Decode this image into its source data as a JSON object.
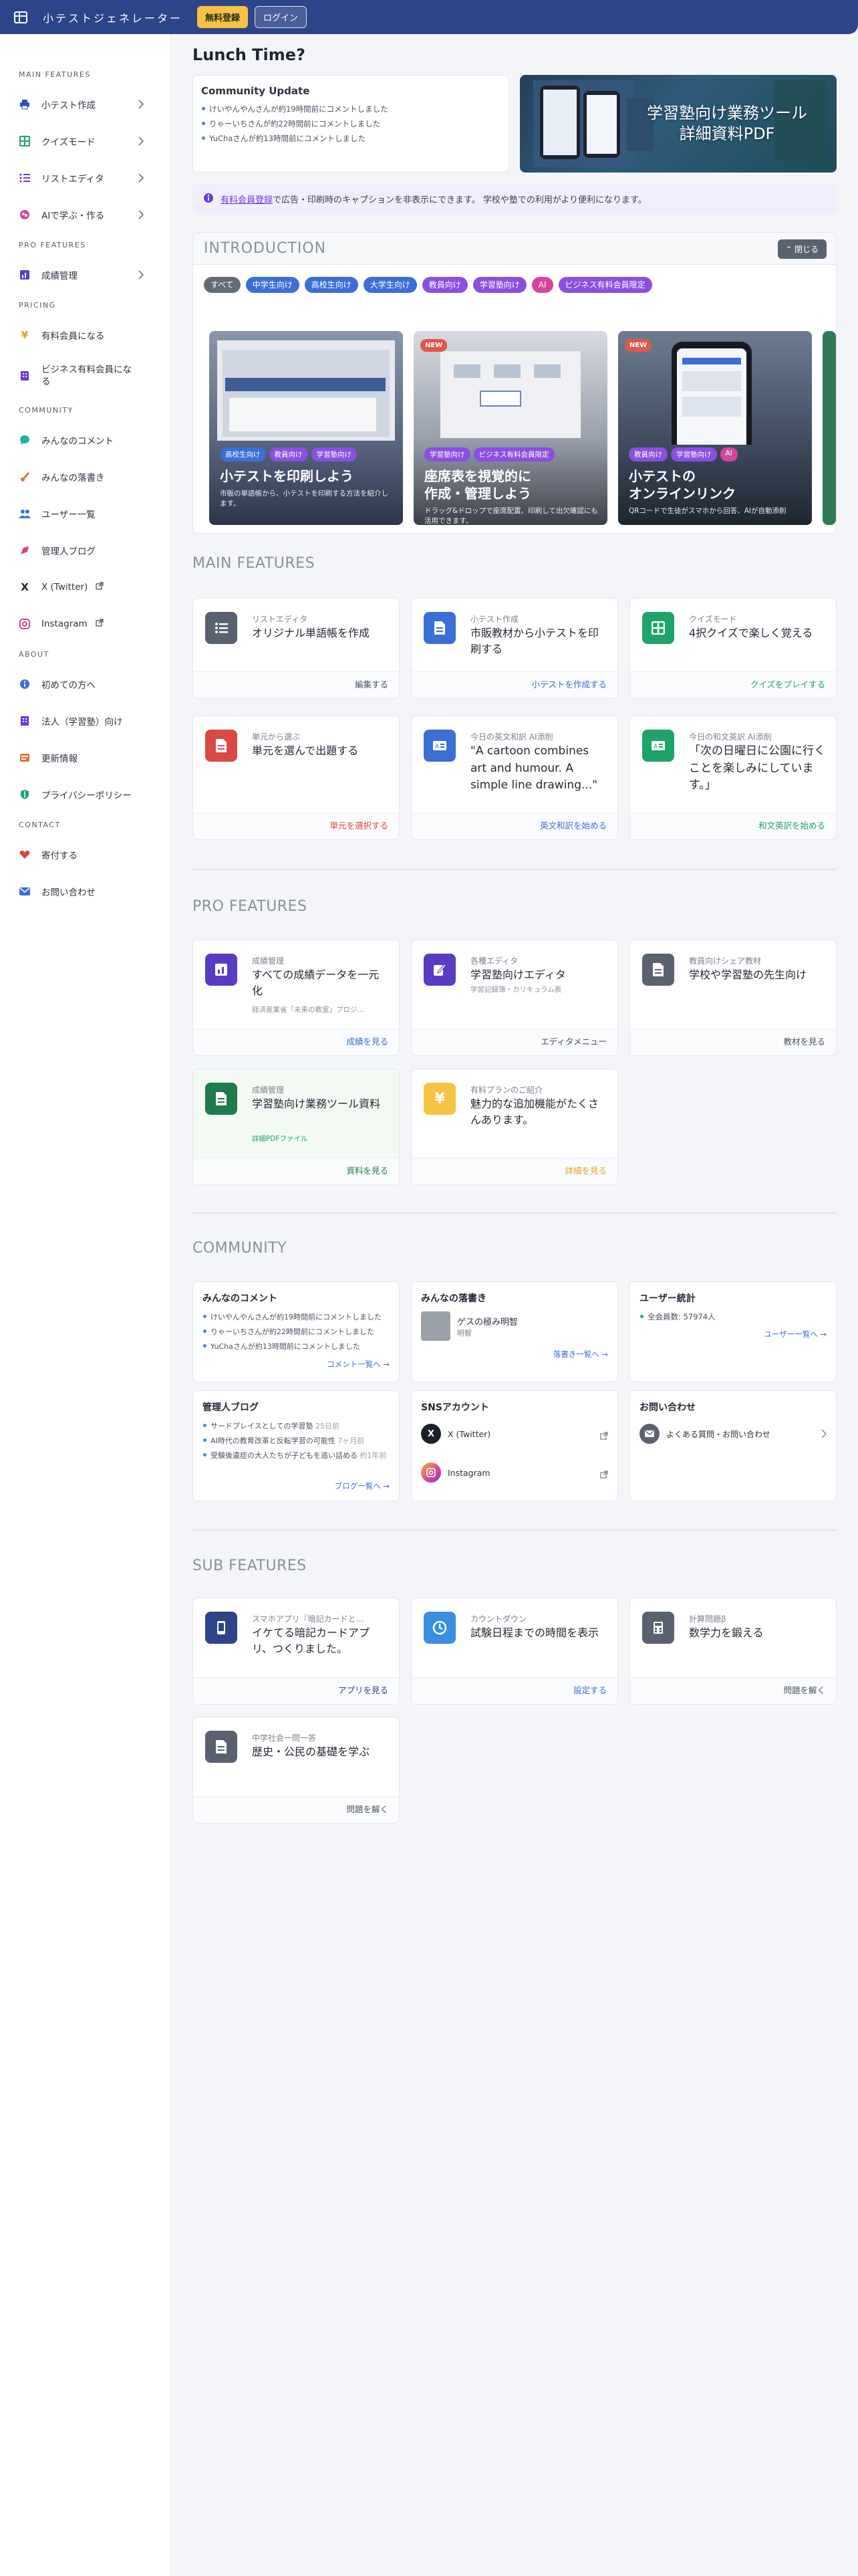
{
  "header": {
    "title": "小テストジェネレーター",
    "register_label": "無料登録",
    "login_label": "ログイン"
  },
  "sidebar": {
    "main_head": "MAIN FEATURES",
    "pro_head": "PRO FEATURES",
    "pricing_head": "PRICING",
    "community_head": "COMMUNITY",
    "about_head": "ABOUT",
    "contact_head": "CONTACT",
    "main": [
      "小テスト作成",
      "クイズモード",
      "リストエディタ",
      "AIで学ぶ・作る"
    ],
    "pro": [
      "成績管理"
    ],
    "pricing": [
      "有料会員になる",
      "ビジネス有料会員になる"
    ],
    "community": [
      "みんなのコメント",
      "みんなの落書き",
      "ユーザー一覧",
      "管理人ブログ",
      "X (Twitter)",
      "Instagram"
    ],
    "about": [
      "初めての方へ",
      "法人（学習塾）向け",
      "更新情報",
      "プライバシーポリシー"
    ],
    "contact": [
      "寄付する",
      "お問い合わせ"
    ]
  },
  "lunch_title": "Lunch Time?",
  "community_update": {
    "title": "Community Update",
    "items": [
      "けいやんやんさんが約19時間前にコメントしました",
      "りゃーいちさんが約22時間前にコメントしました",
      "YuChaさんが約13時間前にコメントしました"
    ]
  },
  "banner": {
    "line1": "学習塾向け業務ツール",
    "line2": "詳細資料PDF"
  },
  "notice": {
    "link": "有料会員登録",
    "text": "で広告・印刷時のキャプションを非表示にできます。 学校や塾での利用がより便利になります。"
  },
  "intro": {
    "title": "INTRODUCTION",
    "close_label": "閉じる",
    "chips": [
      "すべて",
      "中学生向け",
      "高校生向け",
      "大学生向け",
      "教員向け",
      "学習塾向け",
      "AI",
      "ビジネス有料会員限定"
    ],
    "slides": [
      {
        "tags": [
          "高校生向け",
          "教員向け",
          "学習塾向け"
        ],
        "title": "小テストを印刷しよう",
        "desc": "市販の単語帳から、小テストを印刷する方法を紹介します。",
        "new": ""
      },
      {
        "tags": [
          "学習塾向け",
          "ビジネス有料会員限定"
        ],
        "title1": "座席表を視覚的に",
        "title2": "作成・管理しよう",
        "desc": "ドラッグ&ドロップで座席配置。印刷して出欠確認にも活用できます。",
        "new": "NEW"
      },
      {
        "tags": [
          "教員向け",
          "学習塾向け",
          "AI"
        ],
        "title1": "小テストの",
        "title2": "オンラインリンク",
        "desc": "QRコードで生徒がスマホから回答、AIが自動添削",
        "new": "NEW"
      }
    ]
  },
  "main_features": {
    "title": "MAIN FEATURES",
    "cards": [
      {
        "cat": "リストエディタ",
        "title": "オリジナル単語帳を作成",
        "foot": "編集する"
      },
      {
        "cat": "小テスト作成",
        "title": "市販教材から小テストを印刷する",
        "foot": "小テストを作成する"
      },
      {
        "cat": "クイズモード",
        "title": "4択クイズで楽しく覚える",
        "foot": "クイズをプレイする"
      },
      {
        "cat": "単元から選ぶ",
        "title": "単元を選んで出題する",
        "foot": "単元を選択する"
      },
      {
        "cat": "今日の英文和訳 AI添削",
        "title": "\"A cartoon combines art and humour. A simple line drawing...\"",
        "foot": "英文和訳を始める"
      },
      {
        "cat": "今日の和文英訳 AI添削",
        "title": "「次の日曜日に公園に行くことを楽しみにしています。」",
        "foot": "和文英訳を始める"
      }
    ]
  },
  "pro_features": {
    "title": "PRO FEATURES",
    "cards": [
      {
        "cat": "成績管理",
        "title": "すべての成績データを一元化",
        "sub": "経済産業省「未来の教室」プロジ…",
        "foot": "成績を見る"
      },
      {
        "cat": "各種エディタ",
        "title": "学習塾向けエディタ",
        "sub": "学習記録簿・カリキュラム表",
        "foot": "エディタメニュー"
      },
      {
        "cat": "教員向けシェア教材",
        "title": "学校や学習塾の先生向け",
        "sub": "",
        "foot": "教材を見る"
      },
      {
        "cat": "成績管理",
        "title": "学習塾向け業務ツール資料",
        "sub": "詳細PDFファイル",
        "foot": "資料を見る"
      },
      {
        "cat": "有料プランのご紹介",
        "title": "魅力的な追加機能がたくさんあります。",
        "sub": "",
        "foot": "詳細を見る"
      }
    ]
  },
  "community": {
    "title": "COMMUNITY",
    "comments": {
      "title": "みんなのコメント",
      "items": [
        "けいやんやんさんが約19時間前にコメントしました",
        "りゃーいちさんが約22時間前にコメントしました",
        "YuChaさんが約13時間前にコメントしました"
      ],
      "more": "コメント一覧へ →"
    },
    "graffiti": {
      "title": "みんなの落書き",
      "name": "ゲスの極み明智",
      "user": "明智",
      "more": "落書き一覧へ →"
    },
    "users": {
      "title": "ユーザー統計",
      "total": "全会員数: 57974人",
      "more": "ユーザー一覧へ →"
    },
    "blog": {
      "title": "管理人ブログ",
      "items": [
        {
          "t": "サードプレイスとしての学習塾",
          "d": "25日前"
        },
        {
          "t": "AI時代の教育改革と反転学習の可能性",
          "d": "7ヶ月前"
        },
        {
          "t": "受験後遺症の大人たちが子どもを追い詰める",
          "d": "約1年前"
        }
      ],
      "more": "ブログ一覧へ →"
    },
    "sns": {
      "title": "SNSアカウント",
      "x": "X (Twitter)",
      "ig": "Instagram"
    },
    "contact": {
      "title": "お問い合わせ",
      "item": "よくある質問・お問い合わせ"
    }
  },
  "sub_features": {
    "title": "SUB FEATURES",
    "cards": [
      {
        "cat": "スマホアプリ『暗記カードと…",
        "title": "イケてる暗記カードアプリ、つくりました。",
        "foot": "アプリを見る"
      },
      {
        "cat": "カウントダウン",
        "title": "試験日程までの時間を表示",
        "foot": "設定する"
      },
      {
        "cat": "計算問題β",
        "title": "数学力を鍛える",
        "foot": "問題を解く"
      },
      {
        "cat": "中学社会一問一答",
        "title": "歴史・公民の基礎を学ぶ",
        "foot": "問題を解く"
      }
    ]
  },
  "colors": {
    "header": "#2d4488",
    "primary": "#3b6fd6",
    "green": "#1fa36b",
    "red": "#d94a45",
    "gold": "#e3a21a",
    "purple": "#6b3bd6"
  }
}
